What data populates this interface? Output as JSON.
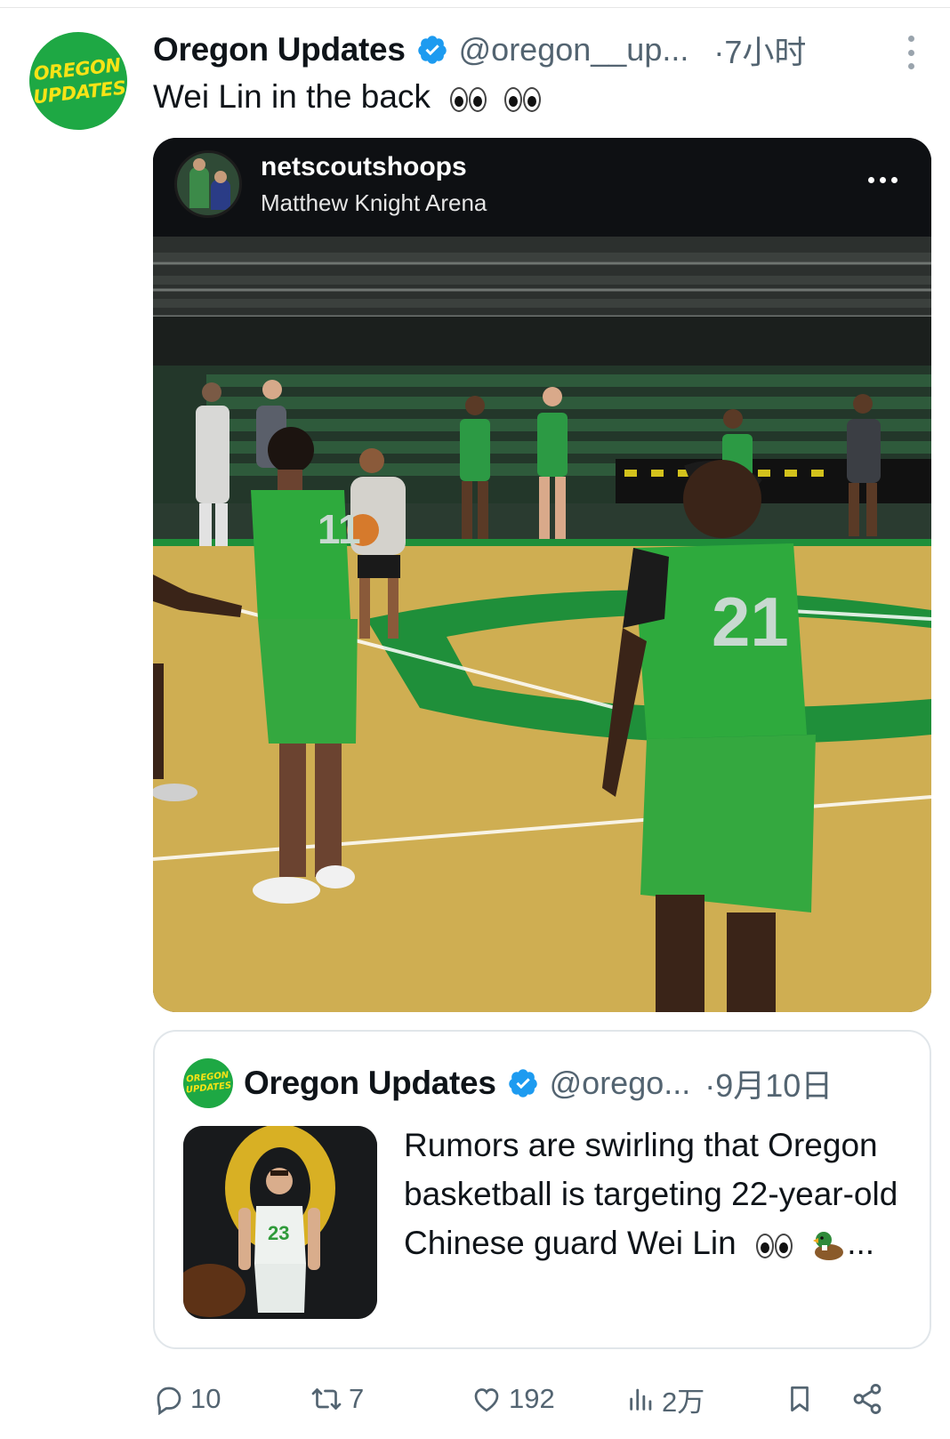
{
  "post": {
    "author": {
      "name": "Oregon Updates",
      "handle": "@oregon__up...",
      "verified": true,
      "avatar_text": [
        "OREGON",
        "UPDATES"
      ],
      "avatar_colors": {
        "bg": "#1ea844",
        "fg": "#f7e316"
      }
    },
    "time": "·7小时",
    "text": "Wei Lin in the back",
    "emoji_icons": [
      "eyes-emoji",
      "eyes-emoji"
    ]
  },
  "embedded_media": {
    "username": "netscoutshoops",
    "location": "Matthew Knight Arena",
    "jersey_numbers": [
      "11",
      "21"
    ]
  },
  "quoted_post": {
    "author": {
      "name": "Oregon Updates",
      "handle": "@orego...",
      "verified": true,
      "avatar_text": [
        "OREGON",
        "UPDATES"
      ]
    },
    "time": "·9月10日",
    "text": "Rumors are swirling that Oregon basketball is targeting 22-year-old Chinese guard Wei Lin",
    "trailing_icons": [
      "eyes-emoji",
      "duck-emoji"
    ],
    "ellipsis": "...",
    "thumb_jersey": "23"
  },
  "actions": {
    "reply_count": "10",
    "repost_count": "7",
    "like_count": "192",
    "view_count": "2万"
  },
  "colors": {
    "verified": "#1d9bf0",
    "secondary_text": "#536471",
    "oregon_green": "#1ea844",
    "oregon_yellow": "#f7e316"
  }
}
